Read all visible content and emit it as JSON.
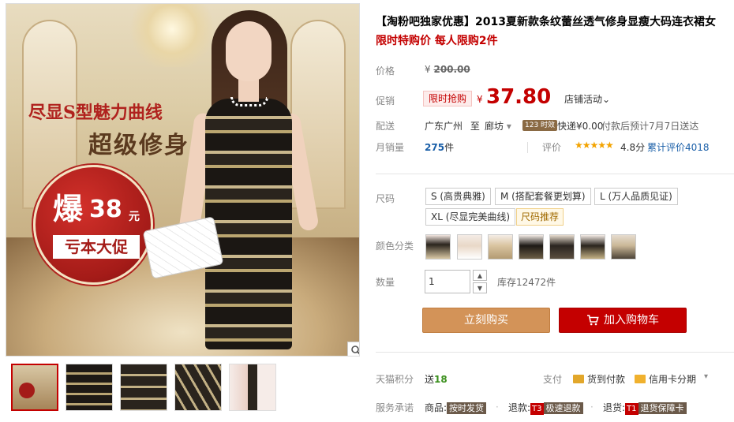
{
  "gallery": {
    "promo_line1": "尽显S型魅力曲线",
    "promo_line2": "超级修身",
    "badge_burst": "爆",
    "badge_price": "38",
    "badge_unit": "元",
    "badge_sub": "亏本大促",
    "zoom_icon": "search-icon",
    "thumbnails": [
      {
        "name": "front-view",
        "active": true
      },
      {
        "name": "fabric-detail"
      },
      {
        "name": "fabric-closeup"
      },
      {
        "name": "sleeve-detail"
      },
      {
        "name": "model-pose"
      }
    ]
  },
  "product": {
    "title": "【淘粉吧独家优惠】2013夏新款条纹蕾丝透气修身显瘦大码连衣裙女",
    "subtitle": "限时特购价 每人限购2件"
  },
  "price": {
    "label": "价格",
    "currency": "¥",
    "original": "200.00"
  },
  "promo": {
    "label": "促销",
    "tag": "限时抢购",
    "currency": "¥",
    "price": "37.80",
    "store_activity": "店铺活动",
    "store_activity_chevron": "⌄"
  },
  "shipping": {
    "label": "配送",
    "from": "广东广州",
    "to_word": "至",
    "to": "廊坊",
    "to_chevron": "▾",
    "badge": "123 时效",
    "fee": "快递¥0.00",
    "note": "付款后预计7月7日送达"
  },
  "sales": {
    "label": "月销量",
    "count": "275",
    "unit": "件",
    "rating_label": "评价",
    "stars": "★★★★★",
    "score": "4.8分",
    "reviews": "累计评价4018"
  },
  "size": {
    "label": "尺码",
    "options": [
      "S (高贵典雅)",
      "M (搭配套餐更划算)",
      "L (万人品质见证)",
      "XL (尽显完美曲线)"
    ],
    "recommend": "尺码推荐"
  },
  "color": {
    "label": "颜色分类",
    "count": 7
  },
  "quantity": {
    "label": "数量",
    "value": "1",
    "up": "▲",
    "down": "▼",
    "stock": "库存12472件"
  },
  "actions": {
    "buy_now": "立刻购买",
    "add_to_cart": "加入购物车"
  },
  "points": {
    "label": "天猫积分",
    "text": "送",
    "value": "18"
  },
  "payment": {
    "label": "支付",
    "cod": "货到付款",
    "credit": "信用卡分期",
    "chevron": "▾"
  },
  "service": {
    "label": "服务承诺",
    "item1_text": "商品:",
    "item1_chip": "按时发货",
    "item2_text": "退款:",
    "item2_badge": "T3",
    "item2_chip": "极速退款",
    "item3_text": "退货:",
    "item3_badge": "T1",
    "item3_chip": "退货保障卡"
  },
  "colors": {
    "accent_red": "#c40000",
    "buy_orange": "#d39358",
    "link_blue": "#1a5fa8",
    "star_gold": "#f3a300"
  }
}
